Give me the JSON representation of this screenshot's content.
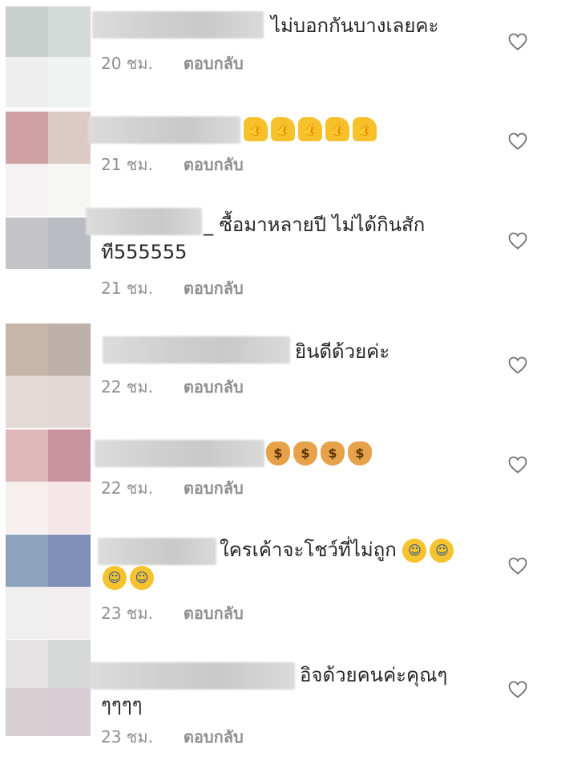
{
  "colors": {
    "text": "#262626",
    "meta": "#8e8e8e",
    "heart_outline": "#737373"
  },
  "comments": [
    {
      "text": "ไม่บอกกันบางเลยคะ",
      "time": "20 ชม.",
      "reply": "ตอบกลับ",
      "avatar_colors": [
        "#c8cfcd",
        "#d3dad8",
        "#eeeeee",
        "#f1f2f2"
      ]
    },
    {
      "text": "",
      "emoji": [
        "thumbs-up",
        "thumbs-up",
        "thumbs-up",
        "thumbs-up",
        "thumbs-up"
      ],
      "time": "21 ชม.",
      "reply": "ตอบกลับ",
      "avatar_colors": [
        "#cfa3a6",
        "#dccac5",
        "#f6f2f3",
        "#f6f6f5"
      ]
    },
    {
      "text_line1": "_ ซื้อมาหลายปี  ไม่ได้กินสัก",
      "text_line2": "ที555555",
      "time": "21 ชม.",
      "reply": "ตอบกลับ",
      "avatar_colors": [
        "#c4c4c8",
        "#b9bdc3",
        "#ffffff",
        "#ffffff"
      ]
    },
    {
      "text": "ยินดีด้วยค่ะ",
      "time": "22 ชม.",
      "reply": "ตอบกลับ",
      "avatar_colors": [
        "#c6b6aa",
        "#bdb0a8",
        "#e3dad6",
        "#e1d8d5"
      ]
    },
    {
      "text": "",
      "emoji": [
        "money-bag",
        "money-bag",
        "money-bag",
        "money-bag"
      ],
      "time": "22 ชม.",
      "reply": "ตอบกลับ",
      "avatar_colors": [
        "#deb8bb",
        "#c993a0",
        "#f7efee",
        "#f5e6e8"
      ]
    },
    {
      "text_line1": "ใครเค้าจะโชว์ที่ไม่ถูก",
      "emoji": [
        "rolling-laugh",
        "rolling-laugh"
      ],
      "emoji_line2": [
        "rolling-laugh",
        "rolling-laugh"
      ],
      "time": "23 ชม.",
      "reply": "ตอบกลับ",
      "avatar_colors": [
        "#8da3bd",
        "#808fb6",
        "#efeff0",
        "#f2eef0"
      ]
    },
    {
      "text_line1": "อิจด้วยคนค่ะคุณๆ",
      "text_line2": "ๆๆๆๆ",
      "time": "23 ชม.",
      "reply": "ตอบกลับ",
      "avatar_colors": [
        "#e5e2e3",
        "#d6d9d7",
        "#d9d0d4",
        "#d8cbd3"
      ]
    }
  ]
}
